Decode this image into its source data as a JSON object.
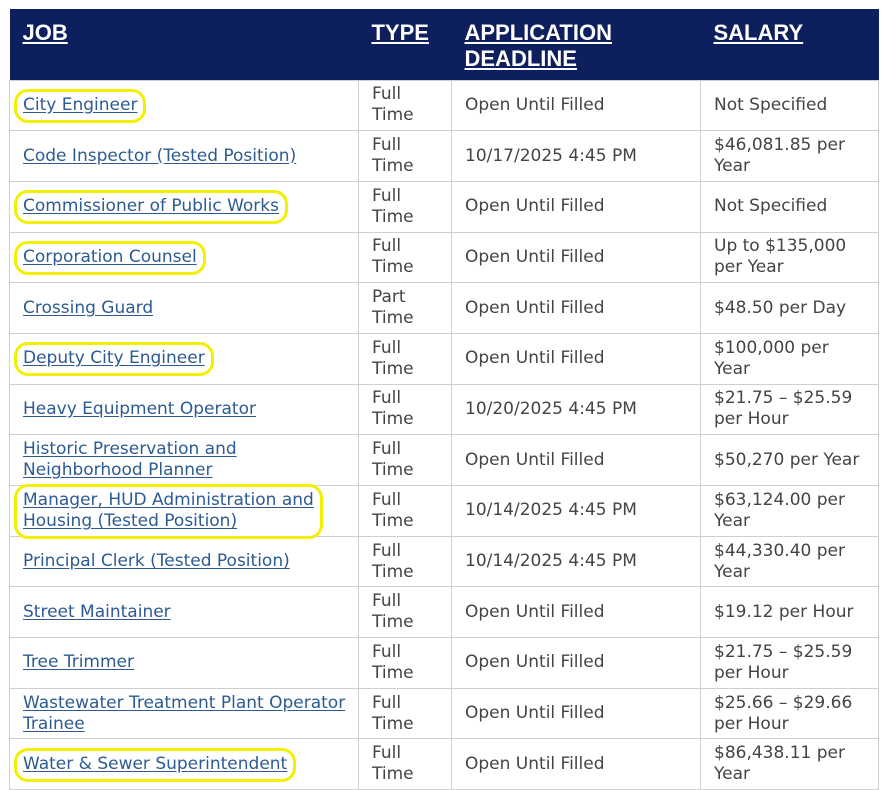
{
  "header": {
    "job": "JOB",
    "type": "TYPE",
    "deadline": "APPLICATION DEADLINE",
    "salary": "SALARY"
  },
  "colors": {
    "header_bg": "#0d1f5c",
    "link": "#2c5b93",
    "highlight": "#f2f000"
  },
  "rows": [
    {
      "job": "City Engineer",
      "type": "Full Time",
      "deadline": "Open Until Filled",
      "salary": "Not Specified",
      "highlighted": true
    },
    {
      "job": "Code Inspector (Tested Position)",
      "type": "Full Time",
      "deadline": "10/17/2025 4:45 PM",
      "salary": "$46,081.85 per Year",
      "highlighted": false
    },
    {
      "job": "Commissioner of Public Works",
      "type": "Full Time",
      "deadline": "Open Until Filled",
      "salary": "Not Specified",
      "highlighted": true
    },
    {
      "job": "Corporation Counsel",
      "type": "Full Time",
      "deadline": "Open Until Filled",
      "salary": "Up to $135,000 per Year",
      "highlighted": true
    },
    {
      "job": "Crossing Guard",
      "type": "Part Time",
      "deadline": "Open Until Filled",
      "salary": "$48.50 per Day",
      "highlighted": false
    },
    {
      "job": "Deputy City Engineer",
      "type": "Full Time",
      "deadline": "Open Until Filled",
      "salary": "$100,000 per Year",
      "highlighted": true
    },
    {
      "job": "Heavy Equipment Operator",
      "type": "Full Time",
      "deadline": "10/20/2025 4:45 PM",
      "salary": "$21.75 – $25.59 per Hour",
      "highlighted": false
    },
    {
      "job": "Historic Preservation and Neighborhood Planner",
      "type": "Full Time",
      "deadline": "Open Until Filled",
      "salary": "$50,270 per Year",
      "highlighted": false
    },
    {
      "job": "Manager, HUD Administration and Housing (Tested Position)",
      "type": "Full Time",
      "deadline": "10/14/2025 4:45 PM",
      "salary": "$63,124.00 per Year",
      "highlighted": true
    },
    {
      "job": "Principal Clerk (Tested Position)",
      "type": "Full Time",
      "deadline": "10/14/2025 4:45 PM",
      "salary": "$44,330.40 per Year",
      "highlighted": false
    },
    {
      "job": "Street Maintainer",
      "type": "Full Time",
      "deadline": "Open Until Filled",
      "salary": "$19.12 per Hour",
      "highlighted": false
    },
    {
      "job": "Tree Trimmer",
      "type": "Full Time",
      "deadline": "Open Until Filled",
      "salary": "$21.75 – $25.59 per Hour",
      "highlighted": false
    },
    {
      "job": "Wastewater Treatment Plant Operator Trainee",
      "type": "Full Time",
      "deadline": "Open Until Filled",
      "salary": "$25.66 – $29.66 per Hour",
      "highlighted": false
    },
    {
      "job": "Water & Sewer Superintendent",
      "type": "Full Time",
      "deadline": "Open Until Filled",
      "salary": "$86,438.11 per Year",
      "highlighted": true
    }
  ]
}
